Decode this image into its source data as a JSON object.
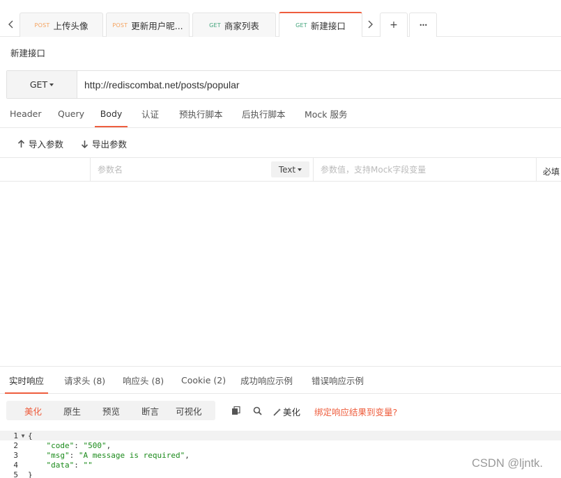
{
  "tabs": [
    {
      "method": "POST",
      "name": "上传头像",
      "active": false
    },
    {
      "method": "POST",
      "name": "更新用户昵...",
      "active": false
    },
    {
      "method": "GET",
      "name": "商家列表",
      "active": false
    },
    {
      "method": "GET",
      "name": "新建接口",
      "active": true
    }
  ],
  "tab_actions": {
    "new_tab": "+",
    "more": "•••"
  },
  "page_title": "新建接口",
  "request": {
    "method": "GET",
    "url": "http://rediscombat.net/posts/popular"
  },
  "request_tabs": [
    "Header",
    "Query",
    "Body",
    "认证",
    "预执行脚本",
    "后执行脚本",
    "Mock 服务"
  ],
  "request_tabs_active": "Body",
  "body_actions": {
    "import": "导入参数",
    "export": "导出参数"
  },
  "param_row": {
    "name_placeholder": "参数名",
    "type": "Text",
    "value_placeholder": "参数值，支持Mock字段变量",
    "required_label": "必填"
  },
  "response_tabs": [
    "实时响应",
    "请求头 (8)",
    "响应头 (8)",
    "Cookie (2)",
    "成功响应示例",
    "错误响应示例"
  ],
  "response_tabs_active": "实时响应",
  "view_modes": [
    "美化",
    "原生",
    "预览",
    "断言",
    "可视化"
  ],
  "view_mode_active": "美化",
  "toolbar": {
    "beautify": "美化",
    "bind_link": "绑定响应结果到变量?"
  },
  "code": {
    "line_numbers": [
      "1",
      "2",
      "3",
      "4",
      "5"
    ],
    "lines": [
      {
        "text": "{"
      },
      {
        "key": "\"code\"",
        "value": "\"500\"",
        "trail": ","
      },
      {
        "key": "\"msg\"",
        "value": "\"A message is required\"",
        "trail": ","
      },
      {
        "key": "\"data\"",
        "value": "\"\"",
        "trail": ""
      },
      {
        "text": "}"
      }
    ]
  },
  "watermark": "CSDN @ljntk.",
  "colors": {
    "accent": "#ee5d3d",
    "post": "#f5a25d",
    "get": "#3fa37a",
    "json": "#1a8a1a"
  }
}
